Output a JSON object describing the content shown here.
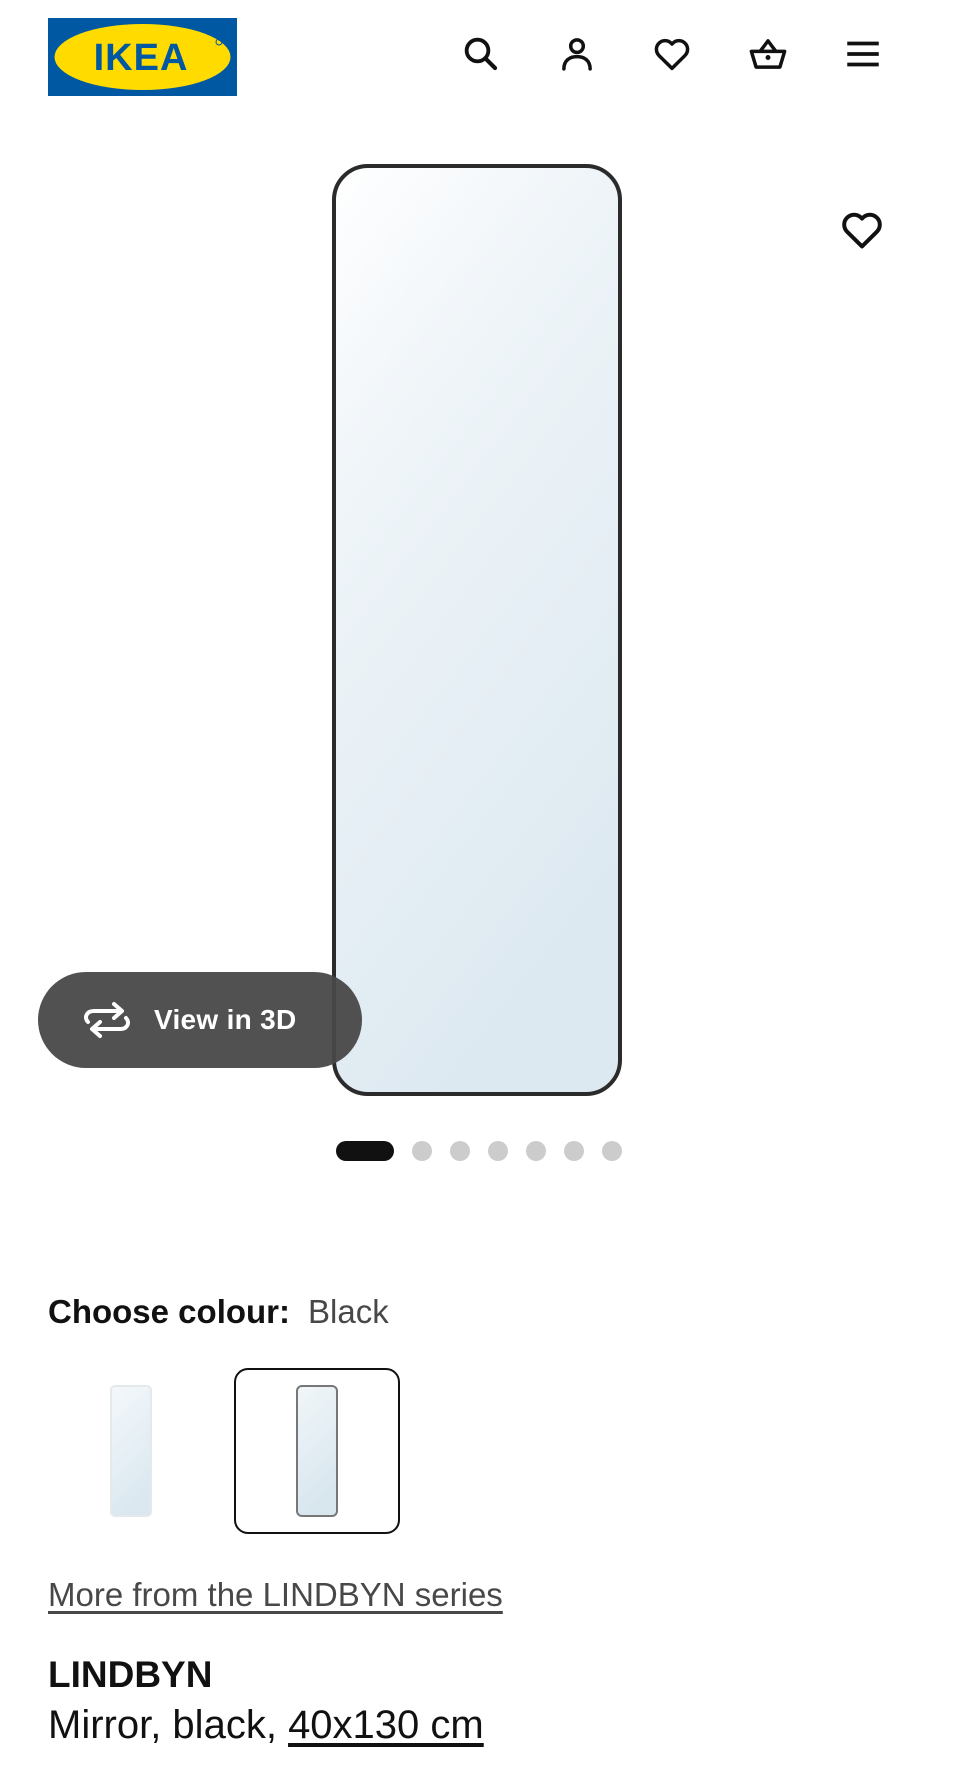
{
  "brand": {
    "logo_text": "IKEA",
    "colors": {
      "blue": "#0058A3",
      "yellow": "#FFDB00"
    }
  },
  "header": {
    "icons": [
      "search-icon",
      "account-icon",
      "heart-icon",
      "cart-icon",
      "menu-icon"
    ]
  },
  "gallery": {
    "view_3d_label": "View in 3D",
    "image_count": 7,
    "active_image": 1
  },
  "colour_chooser": {
    "label": "Choose colour:",
    "selected_value": "Black",
    "options": [
      "White",
      "Black"
    ],
    "selected_index": 1
  },
  "series_link": "More from the LINDBYN series",
  "product": {
    "name": "LINDBYN",
    "description_prefix": "Mirror, black,",
    "size": "40x130 cm"
  }
}
